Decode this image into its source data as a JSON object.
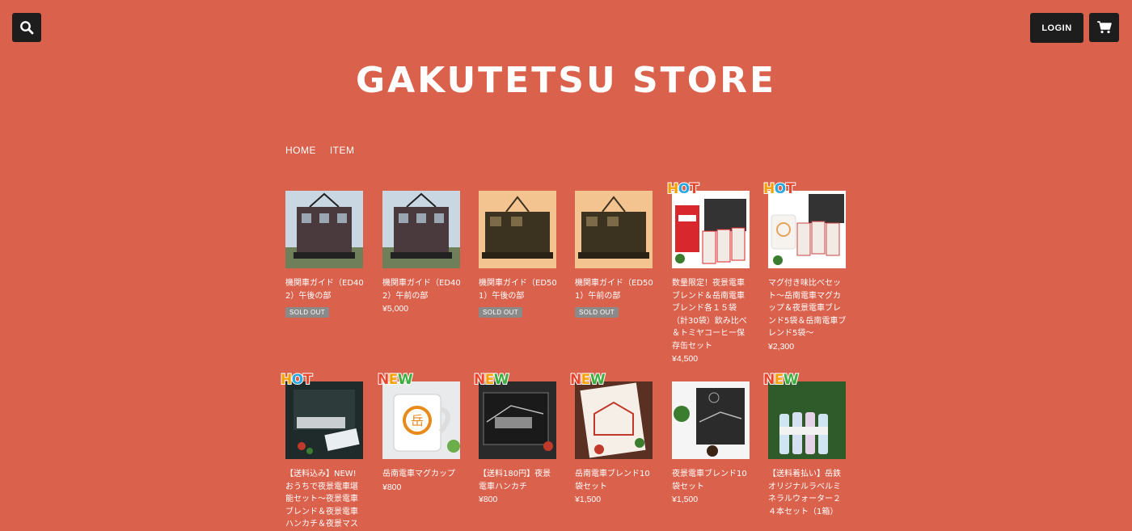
{
  "header": {
    "login_label": "LOGIN",
    "search_icon": "search-icon",
    "cart_icon": "cart-icon"
  },
  "store": {
    "title": "GAKUTETSU STORE"
  },
  "nav": {
    "items": [
      "HOME",
      "ITEM"
    ]
  },
  "colors": {
    "background": "#da614c",
    "button": "#1d1d1d",
    "soldout": "#8a8a8a"
  },
  "products": [
    {
      "name": "機関車ガイド（ED402）午後の部",
      "price": "",
      "soldout": "SOLD OUT",
      "badge": "",
      "image": "electric-locomotive-photo"
    },
    {
      "name": "機関車ガイド（ED402）午前の部",
      "price": "¥5,000",
      "soldout": "",
      "badge": "",
      "image": "electric-locomotive-photo"
    },
    {
      "name": "機関車ガイド（ED501）午後の部",
      "price": "",
      "soldout": "SOLD OUT",
      "badge": "",
      "image": "sepia-locomotive-photo"
    },
    {
      "name": "機関車ガイド（ED501）午前の部",
      "price": "",
      "soldout": "SOLD OUT",
      "badge": "",
      "image": "sepia-locomotive-photo"
    },
    {
      "name": "数量限定！夜景電車ブレンド＆岳南電車ブレンド各１５袋（計30袋）飲み比べ＆トミヤコーヒー保存缶セット",
      "price": "¥4,500",
      "soldout": "",
      "badge": "HOT",
      "image": "coffee-can-set-photo"
    },
    {
      "name": "マグ付き味比べセット〜岳南電車マグカップ＆夜景電車ブレンド5袋＆岳南電車ブレンド5袋〜",
      "price": "¥2,300",
      "soldout": "",
      "badge": "HOT",
      "image": "mug-coffee-set-photo"
    },
    {
      "name": "【送料込み】NEW! おうちで夜景電車堪能セット〜夜景電車ブレンド＆夜景電車ハンカチ＆夜景マス",
      "price": "",
      "soldout": "",
      "badge": "HOT",
      "image": "night-train-set-photo"
    },
    {
      "name": "岳南電車マグカップ",
      "price": "¥800",
      "soldout": "",
      "badge": "NEW",
      "image": "mug-photo"
    },
    {
      "name": "【送料180円】夜景電車ハンカチ",
      "price": "¥800",
      "soldout": "",
      "badge": "NEW",
      "image": "handkerchief-photo"
    },
    {
      "name": "岳南電車ブレンド10袋セット",
      "price": "¥1,500",
      "soldout": "",
      "badge": "NEW",
      "image": "coffee-bag-photo"
    },
    {
      "name": "夜景電車ブレンド10袋セット",
      "price": "¥1,500",
      "soldout": "",
      "badge": "NEW",
      "image": "night-coffee-bag-photo"
    },
    {
      "name": "【送料着払い】岳鉄オリジナルラベルミネラルウォーター２４本セット（1箱）",
      "price": "",
      "soldout": "",
      "badge": "NEW",
      "image": "water-bottles-photo"
    }
  ]
}
